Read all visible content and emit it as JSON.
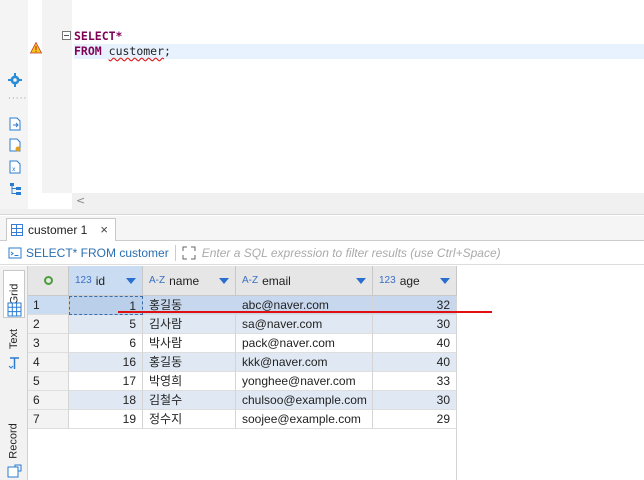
{
  "editor": {
    "line1": {
      "keyword": "SELECT",
      "rest": "*"
    },
    "line2": {
      "keyword": "FROM",
      "table": "customer",
      "terminator": ";"
    },
    "scroll_left": "<"
  },
  "results_tab": {
    "label": "customer 1",
    "close": "×"
  },
  "filter": {
    "query": "SELECT* FROM customer",
    "placeholder": "Enter a SQL expression to filter results (use Ctrl+Space)"
  },
  "side_tabs": {
    "grid": "Grid",
    "text": "Text",
    "record": "Record"
  },
  "columns": [
    {
      "type": "123",
      "name": "id"
    },
    {
      "type": "A-Z",
      "name": "name"
    },
    {
      "type": "A-Z",
      "name": "email"
    },
    {
      "type": "123",
      "name": "age"
    }
  ],
  "rows": [
    {
      "n": "1",
      "id": "1",
      "name": "홍길동",
      "email": "abc@naver.com",
      "age": "32"
    },
    {
      "n": "2",
      "id": "5",
      "name": "김사람",
      "email": "sa@naver.com",
      "age": "30"
    },
    {
      "n": "3",
      "id": "6",
      "name": "박사람",
      "email": "pack@naver.com",
      "age": "40"
    },
    {
      "n": "4",
      "id": "16",
      "name": "홍길동",
      "email": "kkk@naver.com",
      "age": "40"
    },
    {
      "n": "5",
      "id": "17",
      "name": "박영희",
      "email": "yonghee@naver.com",
      "age": "33"
    },
    {
      "n": "6",
      "id": "18",
      "name": "김철수",
      "email": "chulsoo@example.com",
      "age": "30"
    },
    {
      "n": "7",
      "id": "19",
      "name": "정수지",
      "email": "soojee@example.com",
      "age": "29"
    }
  ],
  "selected_row": 1,
  "colors": {
    "accent": "#2a6fd0",
    "keyword": "#7f0055",
    "annotation": "#e01010"
  }
}
